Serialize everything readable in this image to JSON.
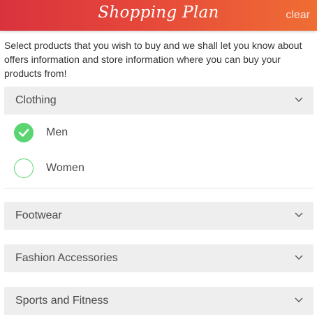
{
  "header": {
    "title": "Shopping Plan",
    "clear_label": "clear"
  },
  "intro": {
    "text": "Select products that you wish to buy and we shall let you know about offers information and store information where you can buy your products from!"
  },
  "sections": [
    {
      "label": "Clothing",
      "expanded": true,
      "options": [
        {
          "label": "Men",
          "selected": true
        },
        {
          "label": "Women",
          "selected": false
        }
      ]
    },
    {
      "label": "Footwear",
      "expanded": false
    },
    {
      "label": "Fashion Accessories",
      "expanded": false
    },
    {
      "label": "Sports and Fitness",
      "expanded": false
    }
  ],
  "colors": {
    "header_gradient_start": "#d9333e",
    "header_gradient_end": "#ef6e34",
    "accent_green": "#5bd472",
    "section_bg": "#eeeeee"
  },
  "icons": {
    "section_toggle": "chevron-down-icon",
    "selected": "checkmark-icon"
  }
}
